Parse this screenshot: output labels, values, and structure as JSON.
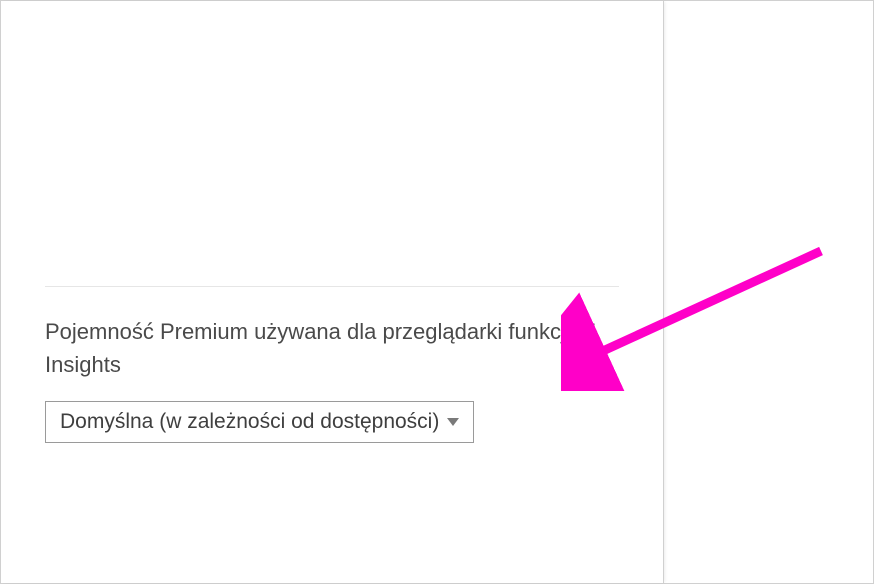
{
  "section": {
    "label": "Pojemność Premium używana dla przeglądarki funkcji AI Insights"
  },
  "dropdown": {
    "selected": "Domyślna (w zależności od dostępności)"
  },
  "annotation": {
    "arrow_color": "#ff00c8"
  }
}
